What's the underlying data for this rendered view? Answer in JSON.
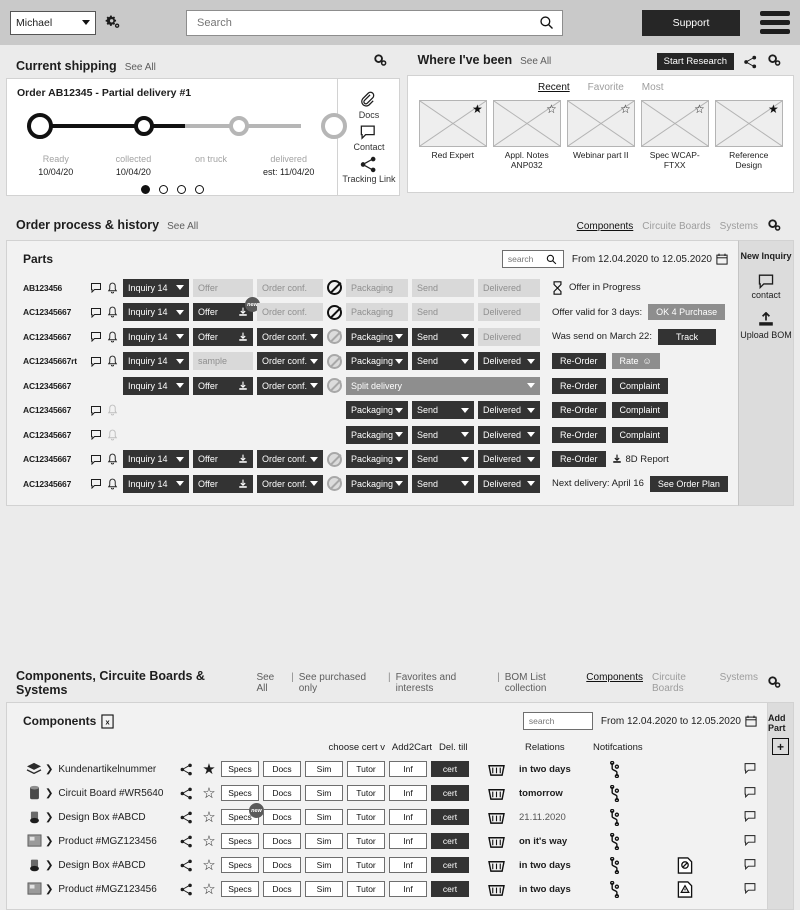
{
  "header": {
    "user": "Michael",
    "settings_icon": "gear-icon",
    "search_placeholder": "Search",
    "search_value": "",
    "support_label": "Support",
    "menu_icon": "hamburger-icon"
  },
  "shipping": {
    "title": "Current shipping",
    "see_all": "See All",
    "order_title": "Order AB12345 - Partial delivery #1",
    "steps": [
      {
        "label": "Ready",
        "date": "10/04/20",
        "state": "done"
      },
      {
        "label": "collected",
        "date": "10/04/20",
        "state": "done"
      },
      {
        "label": "on truck",
        "date": "",
        "state": "pending"
      },
      {
        "label": "delivered",
        "date": "est: 11/04/20",
        "state": "pending"
      }
    ],
    "dots": 4,
    "active_dot": 0,
    "aside": [
      {
        "icon": "paperclip-icon",
        "label": "Docs"
      },
      {
        "icon": "chat-bubble-icon",
        "label": "Contact"
      },
      {
        "icon": "share-icon",
        "label": "Tracking Link"
      }
    ]
  },
  "visited": {
    "title": "Where I've been",
    "see_all": "See All",
    "start_research": "Start Research",
    "tabs": [
      {
        "label": "Recent",
        "active": true
      },
      {
        "label": "Favorite",
        "active": false
      },
      {
        "label": "Most",
        "active": false
      }
    ],
    "items": [
      {
        "label": "Red Expert",
        "favorite": true
      },
      {
        "label": "Appl. Notes ANP032",
        "favorite": false
      },
      {
        "label": "Webinar part II",
        "favorite": false
      },
      {
        "label": "Spec WCAP-FTXX",
        "favorite": false
      },
      {
        "label": "Reference Design",
        "favorite": true
      }
    ]
  },
  "orders": {
    "title": "Order process & history",
    "see_all": "See All",
    "tabs": [
      {
        "label": "Components",
        "active": true
      },
      {
        "label": "Circuite Boards",
        "active": false
      },
      {
        "label": "Systems",
        "active": false
      }
    ],
    "panel_title": "Parts",
    "search_placeholder": "search",
    "search_value": "",
    "date_range": "From 12.04.2020 to 12.05.2020",
    "labels": {
      "inquiry": "Inquiry 14",
      "offer": "Offer",
      "sample": "sample",
      "order_conf": "Order conf.",
      "packaging": "Packaging",
      "send": "Send",
      "delivered": "Delivered",
      "split_delivery": "Split delivery",
      "new_badge": "new"
    },
    "rows": [
      {
        "part": "AB123456",
        "icons": true,
        "inquiry": "dark",
        "offer": "light",
        "offer_new": false,
        "order_conf": "light",
        "packaging": "light",
        "send": "light",
        "delivered": "light",
        "status_icon": "hourglass-icon",
        "status_text": "Offer in Progress",
        "actions": []
      },
      {
        "part": "AC12345667",
        "icons": true,
        "inquiry": "dark",
        "offer": "dark",
        "offer_new": true,
        "order_conf": "light",
        "packaging": "light",
        "send": "light",
        "delivered": "light",
        "status_text": "Offer valid for 3 days:",
        "actions": [
          {
            "label": "OK 4 Purchase",
            "style": "gray"
          }
        ]
      },
      {
        "part": "AC12345667",
        "icons": true,
        "inquiry": "dark",
        "offer": "dark",
        "offer_new": false,
        "order_conf": "dark",
        "packaging": "dark",
        "send": "dark",
        "delivered": "light",
        "status_text": "Was send on March 22:",
        "actions": [
          {
            "label": "Track",
            "style": "dark"
          }
        ]
      },
      {
        "part": "AC12345667rt",
        "icons": true,
        "inquiry": "dark",
        "offer": "sample",
        "offer_new": false,
        "order_conf": "dark",
        "packaging": "dark",
        "send": "dark",
        "delivered": "dark",
        "status_text": "",
        "actions": [
          {
            "label": "Re-Order",
            "style": "dark"
          },
          {
            "label": "Rate",
            "style": "gray",
            "icon": "smiley-icon"
          }
        ]
      },
      {
        "part": "AC12345667",
        "icons": false,
        "inquiry": "dark",
        "offer": "dark",
        "offer_new": false,
        "order_conf": "dark",
        "split": true,
        "status_text": "",
        "actions": [
          {
            "label": "Re-Order",
            "style": "dark"
          },
          {
            "label": "Complaint",
            "style": "dark"
          }
        ]
      },
      {
        "part": "AC12345667",
        "icons": true,
        "partial": true,
        "packaging": "dark",
        "send": "dark",
        "delivered": "dark",
        "status_text": "",
        "actions": [
          {
            "label": "Re-Order",
            "style": "dark"
          },
          {
            "label": "Complaint",
            "style": "dark"
          }
        ]
      },
      {
        "part": "AC12345667",
        "icons": true,
        "partial": true,
        "packaging": "dark",
        "send": "dark",
        "delivered": "dark",
        "status_text": "",
        "actions": [
          {
            "label": "Re-Order",
            "style": "dark"
          },
          {
            "label": "Complaint",
            "style": "dark"
          }
        ]
      },
      {
        "part": "AC12345667",
        "icons": true,
        "inquiry": "dark",
        "offer": "dark",
        "offer_new": false,
        "order_conf": "dark",
        "packaging": "dark",
        "send": "dark",
        "delivered": "dark",
        "status_text": "",
        "actions": [
          {
            "label": "Re-Order",
            "style": "dark"
          }
        ],
        "report": "8D Report"
      },
      {
        "part": "AC12345667",
        "icons": true,
        "inquiry": "dark",
        "offer": "dark",
        "offer_new": false,
        "order_conf": "dark",
        "packaging": "dark",
        "send": "dark",
        "delivered": "dark",
        "status_text": "Next delivery: April 16",
        "actions": [
          {
            "label": "See Order Plan",
            "style": "dark"
          }
        ]
      }
    ],
    "aside": {
      "new_inquiry": "New Inquiry",
      "contact": "contact",
      "upload_bom": "Upload BOM"
    }
  },
  "components": {
    "title": "Components, Circuite Boards & Systems",
    "links": [
      "See All",
      "See purchased only",
      "Favorites and interests",
      "BOM List collection"
    ],
    "tabs": [
      {
        "label": "Components",
        "active": true
      },
      {
        "label": "Circuite Boards",
        "active": false
      },
      {
        "label": "Systems",
        "active": false
      }
    ],
    "panel_title": "Components",
    "export_icon": "excel-export-icon",
    "search_placeholder": "search",
    "search_value": "",
    "date_range": "From 12.04.2020 to 12.05.2020",
    "columns": {
      "cert": "choose cert v",
      "cart": "Add2Cart",
      "del": "Del. till",
      "relations": "Relations",
      "notifications": "Notifcations"
    },
    "action_labels": [
      "Specs",
      "Docs",
      "Sim",
      "Tutor",
      "Inf"
    ],
    "cert_label": "cert",
    "new_badge": "new",
    "rows": [
      {
        "icon": "stack-icon",
        "name": "Kundenartikelnummer",
        "favorite": true,
        "del": "in two days",
        "del_plain": false,
        "notification": "",
        "new_on": ""
      },
      {
        "icon": "capacitor-icon",
        "name": "Circuit Board #WR5640",
        "favorite": false,
        "del": "tomorrow",
        "del_plain": false,
        "notification": "",
        "new_on": ""
      },
      {
        "icon": "inductor-icon",
        "name": "Design Box #ABCD",
        "favorite": false,
        "del": "21.11.2020",
        "del_plain": true,
        "notification": "",
        "new_on": "Specs"
      },
      {
        "icon": "module-icon",
        "name": "Product #MGZ123456",
        "favorite": false,
        "del": "on it's way",
        "del_plain": false,
        "notification": "",
        "new_on": ""
      },
      {
        "icon": "inductor-icon",
        "name": "Design Box #ABCD",
        "favorite": false,
        "del": "in two days",
        "del_plain": false,
        "notification": "doc-blocked-icon",
        "new_on": ""
      },
      {
        "icon": "module-icon",
        "name": "Product #MGZ123456",
        "favorite": false,
        "del": "in two days",
        "del_plain": false,
        "notification": "doc-warning-icon",
        "new_on": ""
      }
    ],
    "aside": {
      "add_part": "Add Part"
    }
  }
}
